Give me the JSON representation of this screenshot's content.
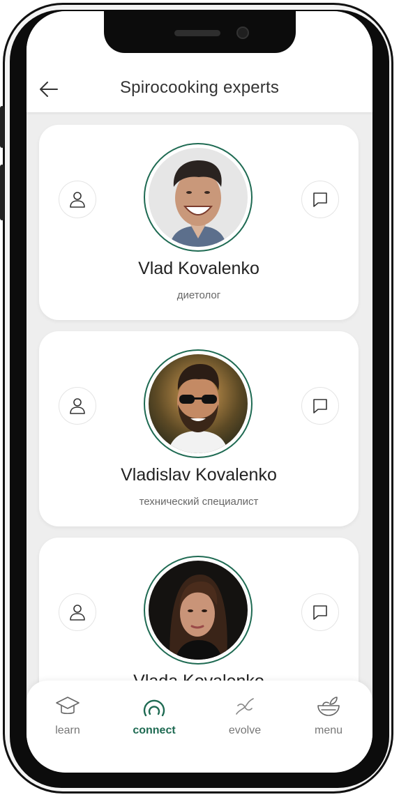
{
  "header": {
    "title": "Spirocooking experts"
  },
  "experts": [
    {
      "name": "Vlad Kovalenko",
      "role": "диетолог"
    },
    {
      "name": "Vladislav Kovalenko",
      "role": "технический специалист"
    },
    {
      "name": "Vlada Kovalenko",
      "role": ""
    }
  ],
  "nav": [
    {
      "label": "learn",
      "icon": "graduation-cap-icon"
    },
    {
      "label": "connect",
      "icon": "connect-icon",
      "active": true
    },
    {
      "label": "evolve",
      "icon": "evolve-icon"
    },
    {
      "label": "menu",
      "icon": "bowl-icon"
    }
  ],
  "colors": {
    "accent": "#1e6a52",
    "background": "#eeeeee"
  }
}
